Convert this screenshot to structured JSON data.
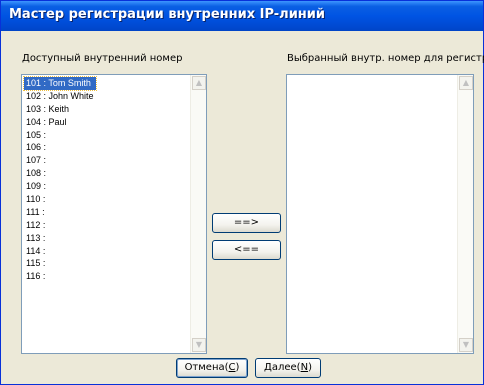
{
  "window": {
    "title": "Мастер регистрации внутренних IP-линий"
  },
  "left_panel": {
    "label": "Доступный внутренний номер",
    "items": [
      "101 : Tom Smith",
      "102 : John White",
      "103 : Keith",
      "104 : Paul",
      "105 :",
      "106 :",
      "107 :",
      "108 :",
      "109 :",
      "110 :",
      "111 :",
      "112 :",
      "113 :",
      "114 :",
      "115 :",
      "116 :"
    ],
    "selected_index": 0
  },
  "right_panel": {
    "label": "Выбранный внутр. номер для регистр.",
    "items": []
  },
  "transfer": {
    "add_label": "==>",
    "remove_label": "<=="
  },
  "footer": {
    "cancel_text": "Отмена(",
    "cancel_key": "C",
    "cancel_tail": ")",
    "next_text": "Далее(",
    "next_key": "N",
    "next_tail": ")"
  },
  "icons": {
    "scroll_up": "▲",
    "scroll_down": "▼"
  }
}
